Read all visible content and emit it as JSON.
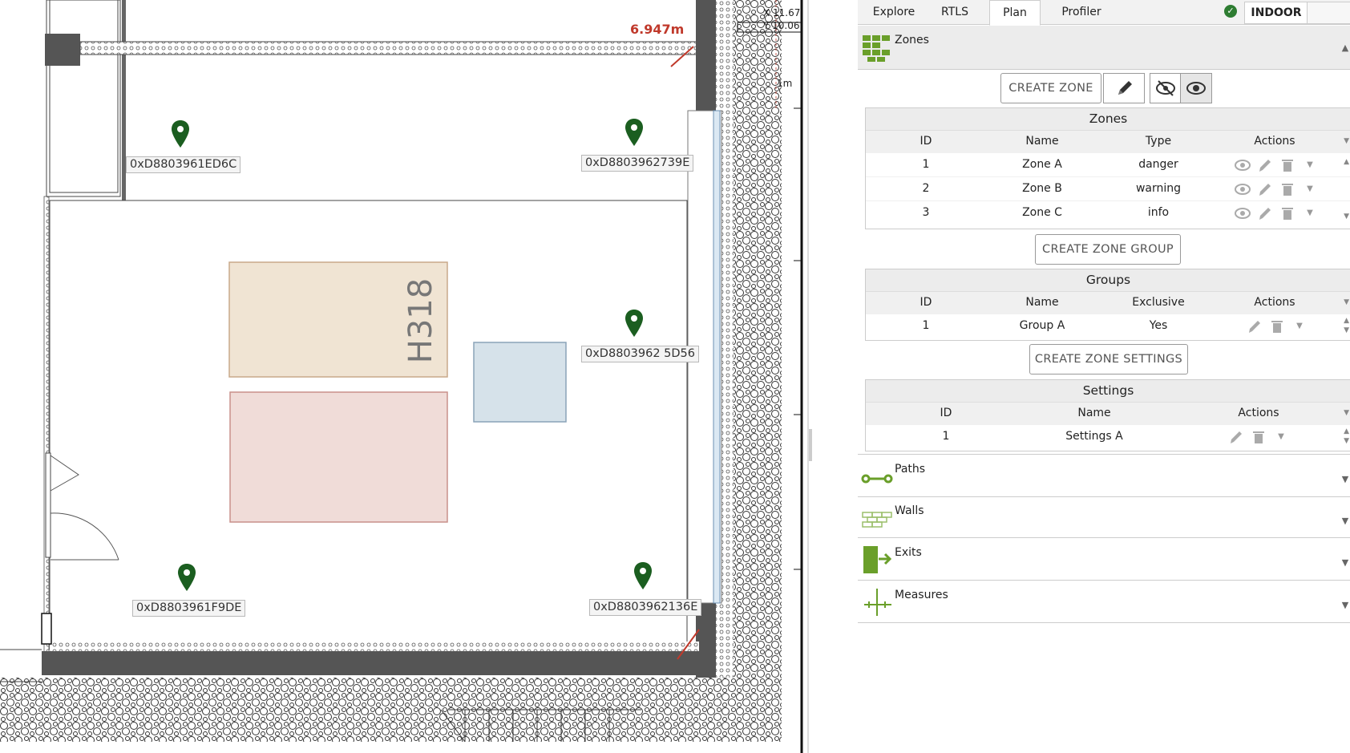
{
  "map": {
    "measure_label": "6.947m",
    "coord_x": "X 11.67",
    "coord_y": "Y 10.06",
    "scale_label": "1m",
    "room_label": "H318",
    "anchors": [
      {
        "label": "0xD8803961ED6C"
      },
      {
        "label": "0xD8803962739E"
      },
      {
        "label": "0xD8803962 5D56"
      },
      {
        "label": "0xD8803961F9DE"
      },
      {
        "label": "0xD8803962136E"
      }
    ],
    "pin_color": "#1b5e20"
  },
  "tabs": [
    {
      "label": "Explore"
    },
    {
      "label": "RTLS"
    },
    {
      "label": "Plan"
    },
    {
      "label": "Profiler"
    }
  ],
  "mode": "INDOOR",
  "zones_section": {
    "title": "Zones",
    "create_zone_label": "CREATE ZONE",
    "zones_table": {
      "caption": "Zones",
      "columns": [
        "ID",
        "Name",
        "Type",
        "Actions"
      ],
      "rows": [
        {
          "id": "1",
          "name": "Zone A",
          "type": "danger"
        },
        {
          "id": "2",
          "name": "Zone B",
          "type": "warning"
        },
        {
          "id": "3",
          "name": "Zone C",
          "type": "info"
        }
      ]
    },
    "create_group_label": "CREATE ZONE GROUP",
    "groups_table": {
      "caption": "Groups",
      "columns": [
        "ID",
        "Name",
        "Exclusive",
        "Actions"
      ],
      "rows": [
        {
          "id": "1",
          "name": "Group A",
          "exclusive": "Yes"
        }
      ]
    },
    "create_settings_label": "CREATE ZONE SETTINGS",
    "settings_table": {
      "caption": "Settings",
      "columns": [
        "ID",
        "Name",
        "Actions"
      ],
      "rows": [
        {
          "id": "1",
          "name": "Settings A"
        }
      ]
    }
  },
  "sections": [
    {
      "title": "Paths"
    },
    {
      "title": "Walls"
    },
    {
      "title": "Exits"
    },
    {
      "title": "Measures"
    }
  ],
  "colors": {
    "accent_green": "#6a9f2a",
    "zone_danger": "#f0dcd8",
    "zone_warning": "#f0e4d3",
    "zone_info": "#d6e2ea"
  }
}
